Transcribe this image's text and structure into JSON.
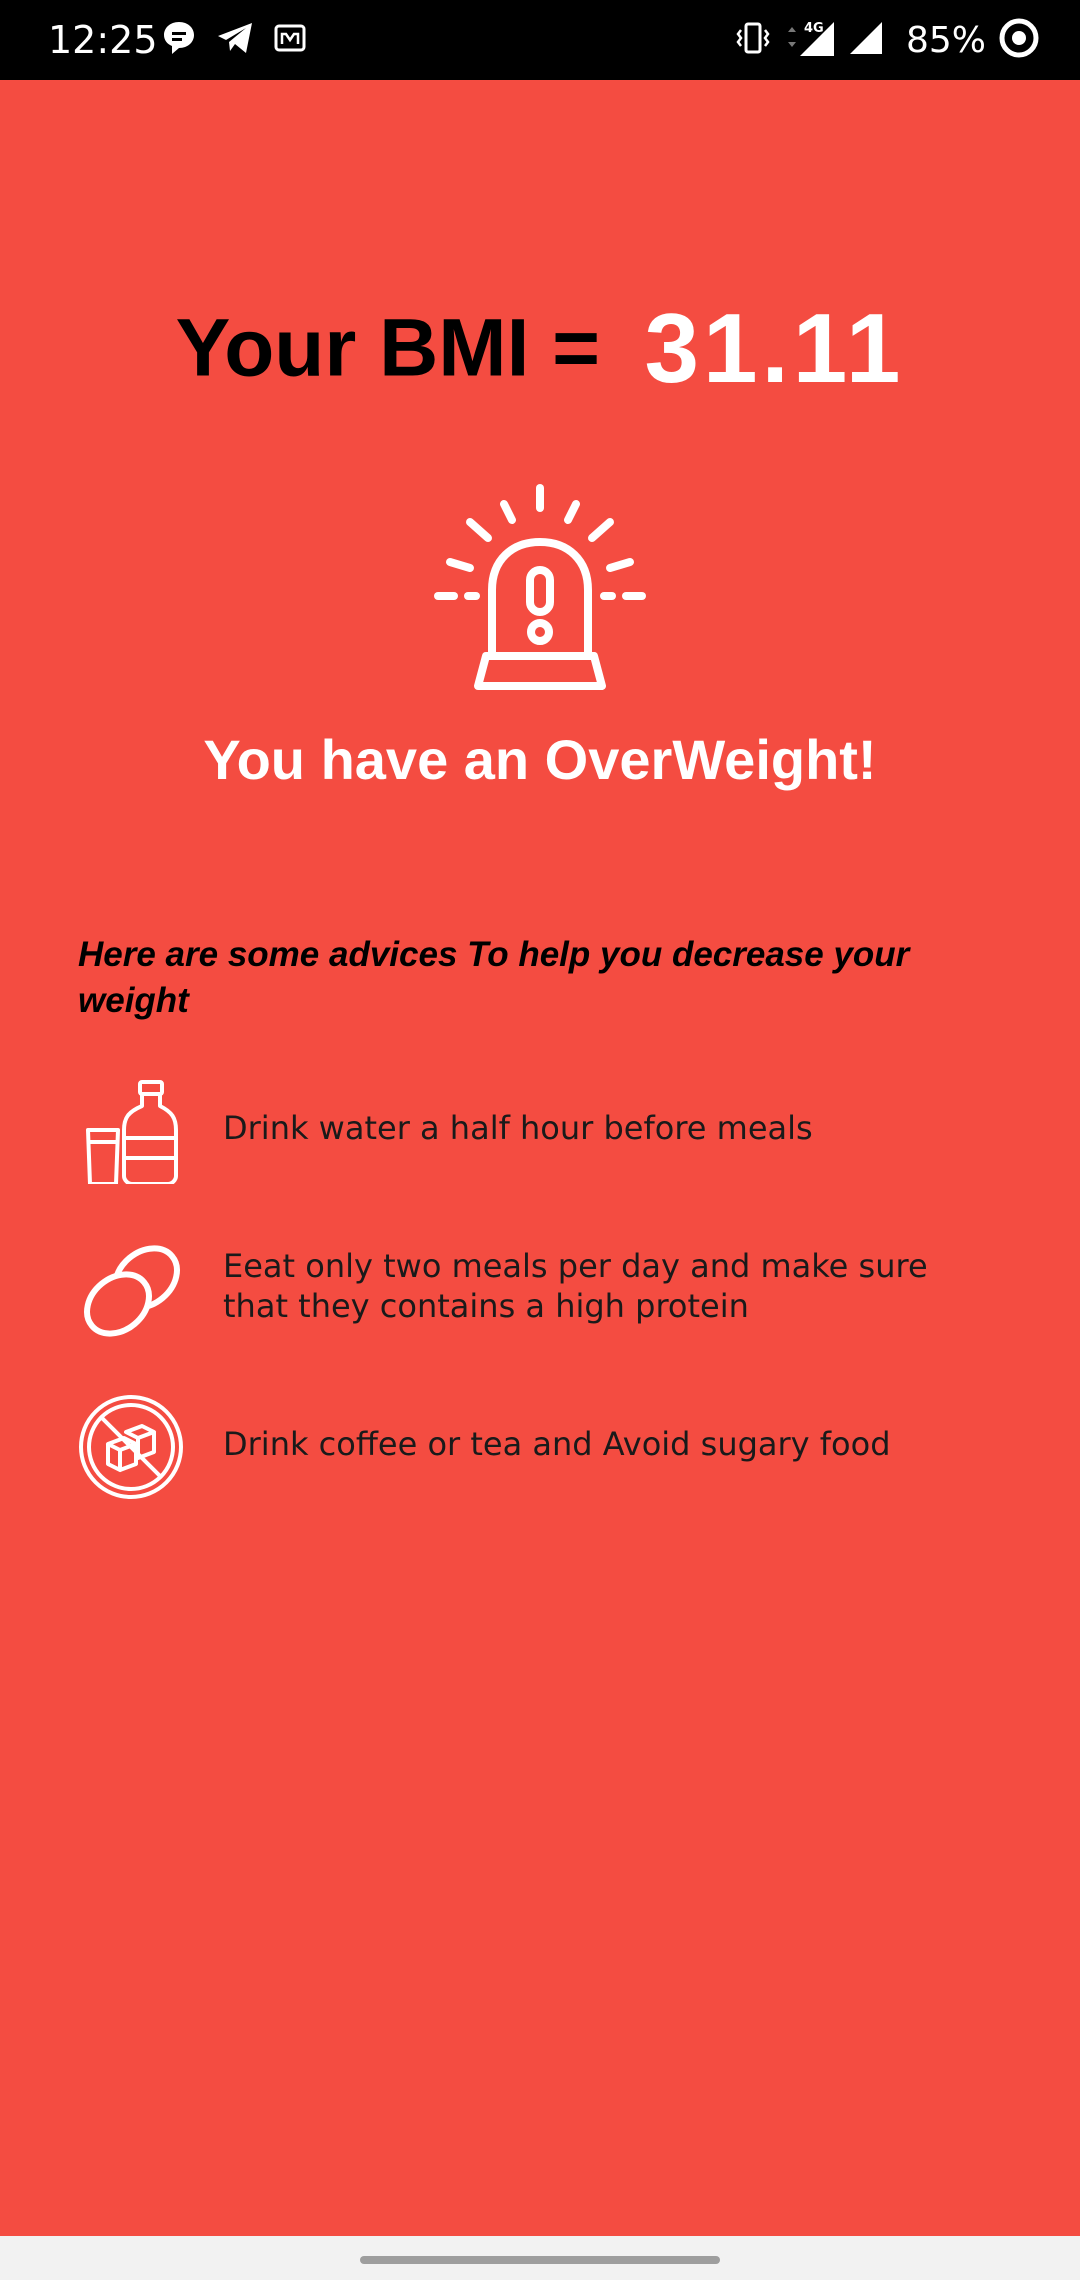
{
  "status_bar": {
    "time": "12:25",
    "network_label": "4G",
    "battery_text": "85%"
  },
  "result": {
    "bmi_label": "Your BMI =",
    "bmi_value": "31.11",
    "category_message": "You have an OverWeight!"
  },
  "advice": {
    "heading": "Here are some advices To help you decrease your weight",
    "items": [
      {
        "icon": "water-bottle-icon",
        "text": "Drink water a half hour before meals"
      },
      {
        "icon": "eggs-icon",
        "text": "Eeat only two meals per day and make sure that they contains a high protein"
      },
      {
        "icon": "no-sugar-icon",
        "text": "Drink coffee or tea and Avoid sugary food"
      }
    ]
  },
  "colors": {
    "background": "#f44c41",
    "accent_text": "#ffffff",
    "dark_text": "#000000"
  }
}
